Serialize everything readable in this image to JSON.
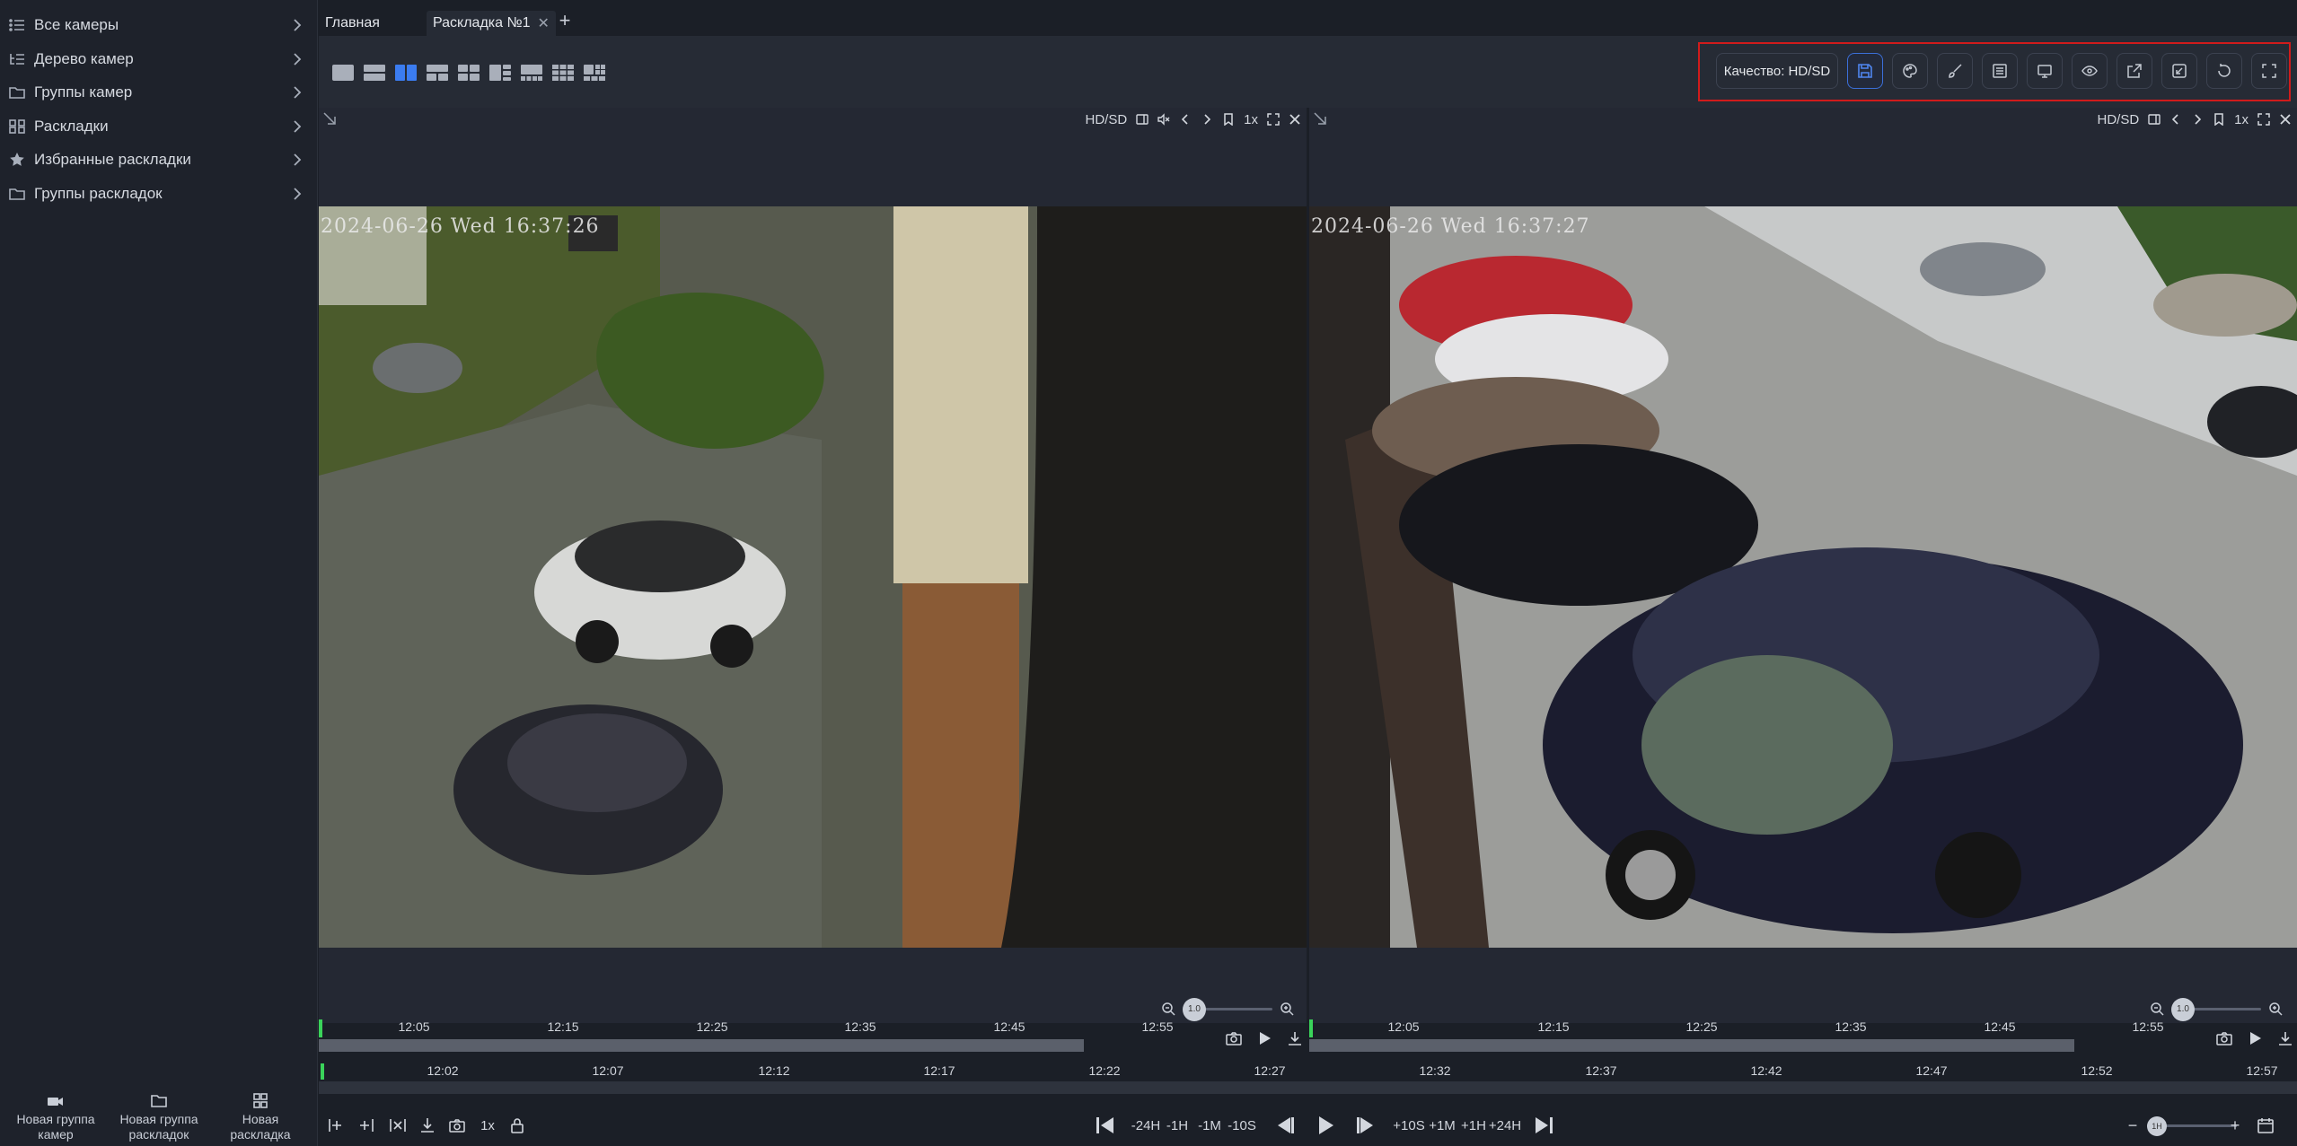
{
  "sidebar": {
    "items": [
      {
        "label": "Все камеры",
        "icon": "list-icon"
      },
      {
        "label": "Дерево камер",
        "icon": "tree-icon"
      },
      {
        "label": "Группы камер",
        "icon": "folder-icon"
      },
      {
        "label": "Раскладки",
        "icon": "grid-icon"
      },
      {
        "label": "Избранные раскладки",
        "icon": "star-icon"
      },
      {
        "label": "Группы раскладок",
        "icon": "folder-icon"
      }
    ],
    "bottom": [
      {
        "label": "Новая группа камер",
        "icon": "camera-icon"
      },
      {
        "label": "Новая группа раскладок",
        "icon": "folder-icon"
      },
      {
        "label": "Новая раскладка",
        "icon": "grid-icon"
      }
    ]
  },
  "tabs": [
    {
      "label": "Главная"
    },
    {
      "label": "Раскладка №1",
      "close": "✕"
    }
  ],
  "tab_add": "+",
  "toolbar": {
    "quality_label": "Качество: HD/SD",
    "buttons": [
      "save-icon",
      "palette-icon",
      "brush-icon",
      "list-icon",
      "monitor-icon",
      "eye-icon",
      "export-icon",
      "resize-icon",
      "refresh-icon",
      "fullscreen-icon"
    ]
  },
  "cameras": [
    {
      "quality": "HD/SD",
      "speed": "1x",
      "timestamp": "2024-06-26 Wed 16:37:26",
      "zoom": "1.0",
      "timeline_ticks": [
        "12:05",
        "12:15",
        "12:25",
        "12:35",
        "12:45",
        "12:55"
      ]
    },
    {
      "quality": "HD/SD",
      "speed": "1x",
      "timestamp": "2024-06-26 Wed 16:37:27",
      "zoom": "1.0",
      "timeline_ticks": [
        "12:05",
        "12:15",
        "12:25",
        "12:35",
        "12:45",
        "12:55"
      ]
    }
  ],
  "global_timeline": {
    "ticks": [
      "12:02",
      "12:07",
      "12:12",
      "12:17",
      "12:22",
      "12:27",
      "12:32",
      "12:37",
      "12:42",
      "12:47",
      "12:52",
      "12:57"
    ]
  },
  "controls": {
    "speed": "1x",
    "jumps_back": [
      "-24H",
      "-1H",
      "-1M",
      "-10S"
    ],
    "jumps_fwd": [
      "+10S",
      "+1M",
      "+1H",
      "+24H"
    ],
    "zoom": "1H"
  },
  "colors": {
    "accent": "#3b6fd8",
    "highlight_border": "#d11b1b",
    "timeline_cursor": "#3ad35a"
  }
}
